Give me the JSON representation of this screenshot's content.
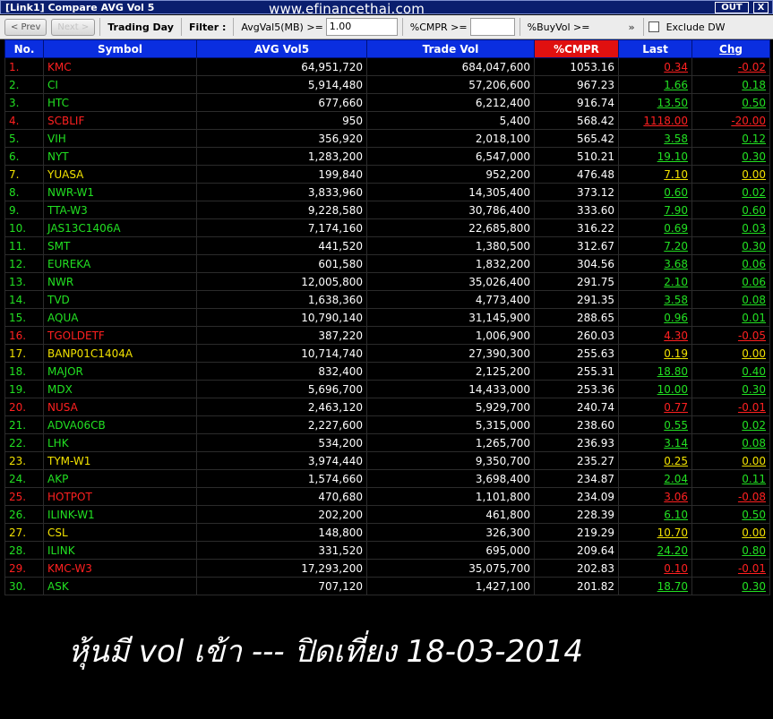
{
  "window": {
    "title": "[Link1] Compare AVG Vol 5",
    "out_label": "OUT",
    "close_label": "X"
  },
  "watermark": "www.efinancethai.com",
  "toolbar": {
    "prev_label": "< Prev",
    "next_label": "Next >",
    "trading_day_label": "Trading Day",
    "filter_label": "Filter :",
    "avgvol_label": "AvgVal5(MB) >=",
    "avgvol_value": "1.00",
    "cmpr_label": "%CMPR >=",
    "cmpr_value": "",
    "buyvol_label": "%BuyVol >=",
    "more_label": "»",
    "exclude_label": "Exclude DW"
  },
  "table": {
    "headers": {
      "no": "No.",
      "symbol": "Symbol",
      "avg": "AVG Vol5",
      "trade": "Trade Vol",
      "cmpr": "%CMPR",
      "last": "Last",
      "chg": "Chg"
    },
    "colors": {
      "green": "#22e022",
      "red": "#ff2020",
      "yellow": "#f2e200",
      "header_blue": "#0a2ee0",
      "header_red": "#e01010"
    },
    "rows": [
      {
        "no": "1.",
        "symbol": "KMC",
        "avg": "64,951,720",
        "trade": "684,047,600",
        "cmpr": "1053.16",
        "last": "0.34",
        "chg": "-0.02",
        "color": "red"
      },
      {
        "no": "2.",
        "symbol": "CI",
        "avg": "5,914,480",
        "trade": "57,206,600",
        "cmpr": "967.23",
        "last": "1.66",
        "chg": "0.18",
        "color": "green"
      },
      {
        "no": "3.",
        "symbol": "HTC",
        "avg": "677,660",
        "trade": "6,212,400",
        "cmpr": "916.74",
        "last": "13.50",
        "chg": "0.50",
        "color": "green"
      },
      {
        "no": "4.",
        "symbol": "SCBLIF",
        "avg": "950",
        "trade": "5,400",
        "cmpr": "568.42",
        "last": "1118.00",
        "chg": "-20.00",
        "color": "red"
      },
      {
        "no": "5.",
        "symbol": "VIH",
        "avg": "356,920",
        "trade": "2,018,100",
        "cmpr": "565.42",
        "last": "3.58",
        "chg": "0.12",
        "color": "green"
      },
      {
        "no": "6.",
        "symbol": "NYT",
        "avg": "1,283,200",
        "trade": "6,547,000",
        "cmpr": "510.21",
        "last": "19.10",
        "chg": "0.30",
        "color": "green"
      },
      {
        "no": "7.",
        "symbol": "YUASA",
        "avg": "199,840",
        "trade": "952,200",
        "cmpr": "476.48",
        "last": "7.10",
        "chg": "0.00",
        "color": "yellow"
      },
      {
        "no": "8.",
        "symbol": "NWR-W1",
        "avg": "3,833,960",
        "trade": "14,305,400",
        "cmpr": "373.12",
        "last": "0.60",
        "chg": "0.02",
        "color": "green"
      },
      {
        "no": "9.",
        "symbol": "TTA-W3",
        "avg": "9,228,580",
        "trade": "30,786,400",
        "cmpr": "333.60",
        "last": "7.90",
        "chg": "0.60",
        "color": "green"
      },
      {
        "no": "10.",
        "symbol": "JAS13C1406A",
        "avg": "7,174,160",
        "trade": "22,685,800",
        "cmpr": "316.22",
        "last": "0.69",
        "chg": "0.03",
        "color": "green"
      },
      {
        "no": "11.",
        "symbol": "SMT",
        "avg": "441,520",
        "trade": "1,380,500",
        "cmpr": "312.67",
        "last": "7.20",
        "chg": "0.30",
        "color": "green"
      },
      {
        "no": "12.",
        "symbol": "EUREKA",
        "avg": "601,580",
        "trade": "1,832,200",
        "cmpr": "304.56",
        "last": "3.68",
        "chg": "0.06",
        "color": "green"
      },
      {
        "no": "13.",
        "symbol": "NWR",
        "avg": "12,005,800",
        "trade": "35,026,400",
        "cmpr": "291.75",
        "last": "2.10",
        "chg": "0.06",
        "color": "green"
      },
      {
        "no": "14.",
        "symbol": "TVD",
        "avg": "1,638,360",
        "trade": "4,773,400",
        "cmpr": "291.35",
        "last": "3.58",
        "chg": "0.08",
        "color": "green"
      },
      {
        "no": "15.",
        "symbol": "AQUA",
        "avg": "10,790,140",
        "trade": "31,145,900",
        "cmpr": "288.65",
        "last": "0.96",
        "chg": "0.01",
        "color": "green"
      },
      {
        "no": "16.",
        "symbol": "TGOLDETF",
        "avg": "387,220",
        "trade": "1,006,900",
        "cmpr": "260.03",
        "last": "4.30",
        "chg": "-0.05",
        "color": "red"
      },
      {
        "no": "17.",
        "symbol": "BANP01C1404A",
        "avg": "10,714,740",
        "trade": "27,390,300",
        "cmpr": "255.63",
        "last": "0.19",
        "chg": "0.00",
        "color": "yellow"
      },
      {
        "no": "18.",
        "symbol": "MAJOR",
        "avg": "832,400",
        "trade": "2,125,200",
        "cmpr": "255.31",
        "last": "18.80",
        "chg": "0.40",
        "color": "green"
      },
      {
        "no": "19.",
        "symbol": "MDX",
        "avg": "5,696,700",
        "trade": "14,433,000",
        "cmpr": "253.36",
        "last": "10.00",
        "chg": "0.30",
        "color": "green"
      },
      {
        "no": "20.",
        "symbol": "NUSA",
        "avg": "2,463,120",
        "trade": "5,929,700",
        "cmpr": "240.74",
        "last": "0.77",
        "chg": "-0.01",
        "color": "red"
      },
      {
        "no": "21.",
        "symbol": "ADVA06CB",
        "avg": "2,227,600",
        "trade": "5,315,000",
        "cmpr": "238.60",
        "last": "0.55",
        "chg": "0.02",
        "color": "green"
      },
      {
        "no": "22.",
        "symbol": "LHK",
        "avg": "534,200",
        "trade": "1,265,700",
        "cmpr": "236.93",
        "last": "3.14",
        "chg": "0.08",
        "color": "green"
      },
      {
        "no": "23.",
        "symbol": "TYM-W1",
        "avg": "3,974,440",
        "trade": "9,350,700",
        "cmpr": "235.27",
        "last": "0.25",
        "chg": "0.00",
        "color": "yellow"
      },
      {
        "no": "24.",
        "symbol": "AKP",
        "avg": "1,574,660",
        "trade": "3,698,400",
        "cmpr": "234.87",
        "last": "2.04",
        "chg": "0.11",
        "color": "green"
      },
      {
        "no": "25.",
        "symbol": "HOTPOT",
        "avg": "470,680",
        "trade": "1,101,800",
        "cmpr": "234.09",
        "last": "3.06",
        "chg": "-0.08",
        "color": "red"
      },
      {
        "no": "26.",
        "symbol": "ILINK-W1",
        "avg": "202,200",
        "trade": "461,800",
        "cmpr": "228.39",
        "last": "6.10",
        "chg": "0.50",
        "color": "green"
      },
      {
        "no": "27.",
        "symbol": "CSL",
        "avg": "148,800",
        "trade": "326,300",
        "cmpr": "219.29",
        "last": "10.70",
        "chg": "0.00",
        "color": "yellow"
      },
      {
        "no": "28.",
        "symbol": "ILINK",
        "avg": "331,520",
        "trade": "695,000",
        "cmpr": "209.64",
        "last": "24.20",
        "chg": "0.80",
        "color": "green"
      },
      {
        "no": "29.",
        "symbol": "KMC-W3",
        "avg": "17,293,200",
        "trade": "35,075,700",
        "cmpr": "202.83",
        "last": "0.10",
        "chg": "-0.01",
        "color": "red"
      },
      {
        "no": "30.",
        "symbol": "ASK",
        "avg": "707,120",
        "trade": "1,427,100",
        "cmpr": "201.82",
        "last": "18.70",
        "chg": "0.30",
        "color": "green"
      }
    ]
  },
  "caption": "หุ้นมี vol เข้า --- ปิดเที่ยง 18-03-2014"
}
